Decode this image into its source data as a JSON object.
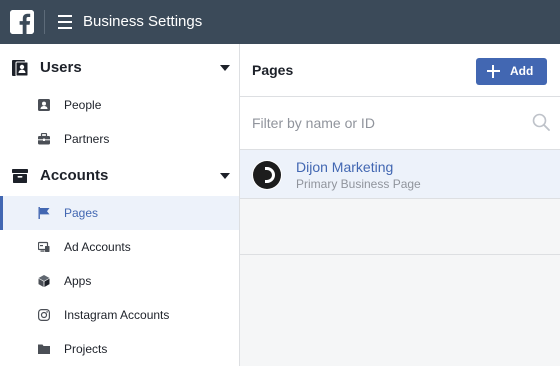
{
  "header": {
    "app_title": "Business Settings",
    "logo_icon": "facebook-logo-icon",
    "menu_icon": "hamburger-menu-icon"
  },
  "sidebar": {
    "sections": [
      {
        "label": "Users",
        "icon": "users-icon",
        "expanded": true,
        "items": [
          {
            "label": "People",
            "icon": "person-card-icon"
          },
          {
            "label": "Partners",
            "icon": "briefcase-icon"
          }
        ]
      },
      {
        "label": "Accounts",
        "icon": "archive-box-icon",
        "expanded": true,
        "items": [
          {
            "label": "Pages",
            "icon": "flag-icon",
            "active": true
          },
          {
            "label": "Ad Accounts",
            "icon": "ad-accounts-icon"
          },
          {
            "label": "Apps",
            "icon": "cube-icon"
          },
          {
            "label": "Instagram Accounts",
            "icon": "instagram-icon"
          },
          {
            "label": "Projects",
            "icon": "folder-icon"
          }
        ]
      }
    ]
  },
  "main": {
    "title": "Pages",
    "add_label": "Add",
    "filter": {
      "placeholder": "Filter by name or ID",
      "value": ""
    },
    "pages": [
      {
        "name": "Dijon Marketing",
        "subtitle": "Primary Business Page"
      }
    ]
  },
  "colors": {
    "topbar": "#3b4a59",
    "accent": "#4267b2",
    "selected_bg": "#edf2fa",
    "muted_text": "#90949c"
  }
}
